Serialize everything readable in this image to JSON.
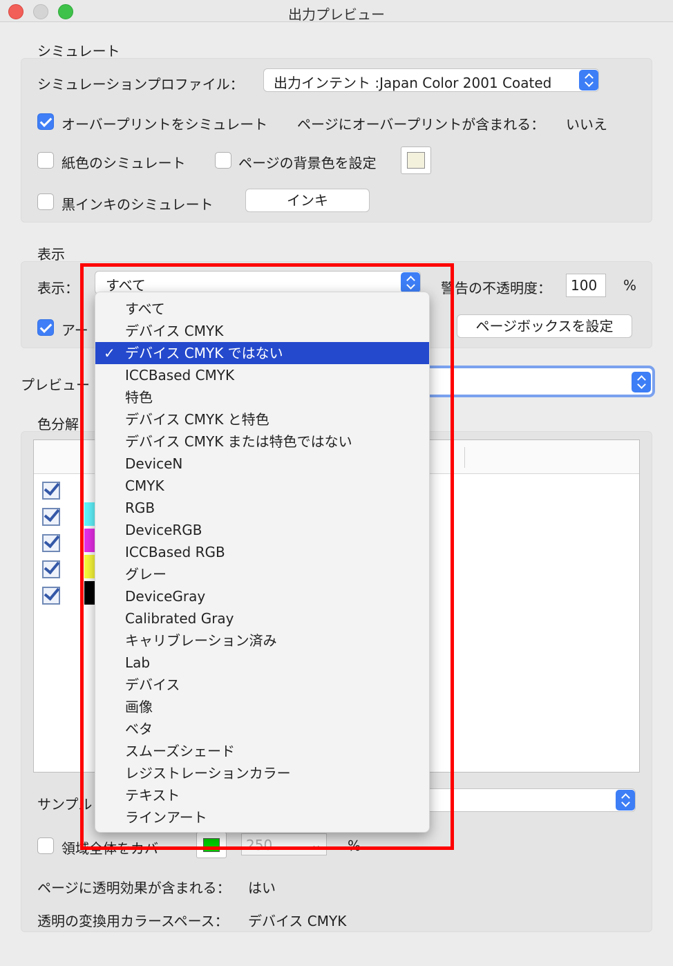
{
  "window": {
    "title": "出力プレビュー"
  },
  "simulate": {
    "group_title": "シミュレート",
    "profile_label": "シミュレーションプロファイル：",
    "profile_value": "出力インテント :Japan Color 2001 Coated",
    "overprint_label": "オーバープリントをシミュレート",
    "overprint_checked": true,
    "page_overprint_label": "ページにオーバープリントが含まれる：",
    "page_overprint_value": "いいえ",
    "paper_color_label": "紙色のシミュレート",
    "bg_color_label": "ページの背景色を設定",
    "black_ink_label": "黒インキのシミュレート",
    "ink_button": "インキ"
  },
  "display": {
    "group_title": "表示",
    "show_label": "表示：",
    "show_value": "すべて",
    "warning_opacity_label": "警告の不透明度：",
    "warning_opacity_value": "100",
    "percent": "%",
    "art_label": "アー",
    "art_checked": true,
    "page_box_button": "ページボックスを設定"
  },
  "preview_label": "プレビュー",
  "separations": {
    "group_title": "色分解",
    "colors": [
      "#ffffff",
      "#60f6ff",
      "#e82ee8",
      "#fafa3a",
      "#000000"
    ]
  },
  "sample_label": "サンプル",
  "cover": {
    "label": "領域全体をカバー",
    "swatch_color": "#00cc00",
    "value": "250",
    "percent": "%"
  },
  "transparency": {
    "page_label": "ページに透明効果が含まれる：",
    "page_value": "はい",
    "cs_label": "透明の変換用カラースペース：",
    "cs_value": "デバイス CMYK"
  },
  "dropdown": {
    "checkmark": "✓",
    "selected_index": 2,
    "items": [
      "すべて",
      "デバイス CMYK",
      "デバイス CMYK ではない",
      "ICCBased CMYK",
      "特色",
      "デバイス CMYK と特色",
      "デバイス CMYK または特色ではない",
      "DeviceN",
      "CMYK",
      "RGB",
      "DeviceRGB",
      "ICCBased RGB",
      "グレー",
      "DeviceGray",
      "Calibrated Gray",
      "キャリブレーション済み",
      "Lab",
      "デバイス",
      "画像",
      "ベタ",
      "スムーズシェード",
      "レジストレーションカラー",
      "テキスト",
      "ラインアート"
    ]
  }
}
